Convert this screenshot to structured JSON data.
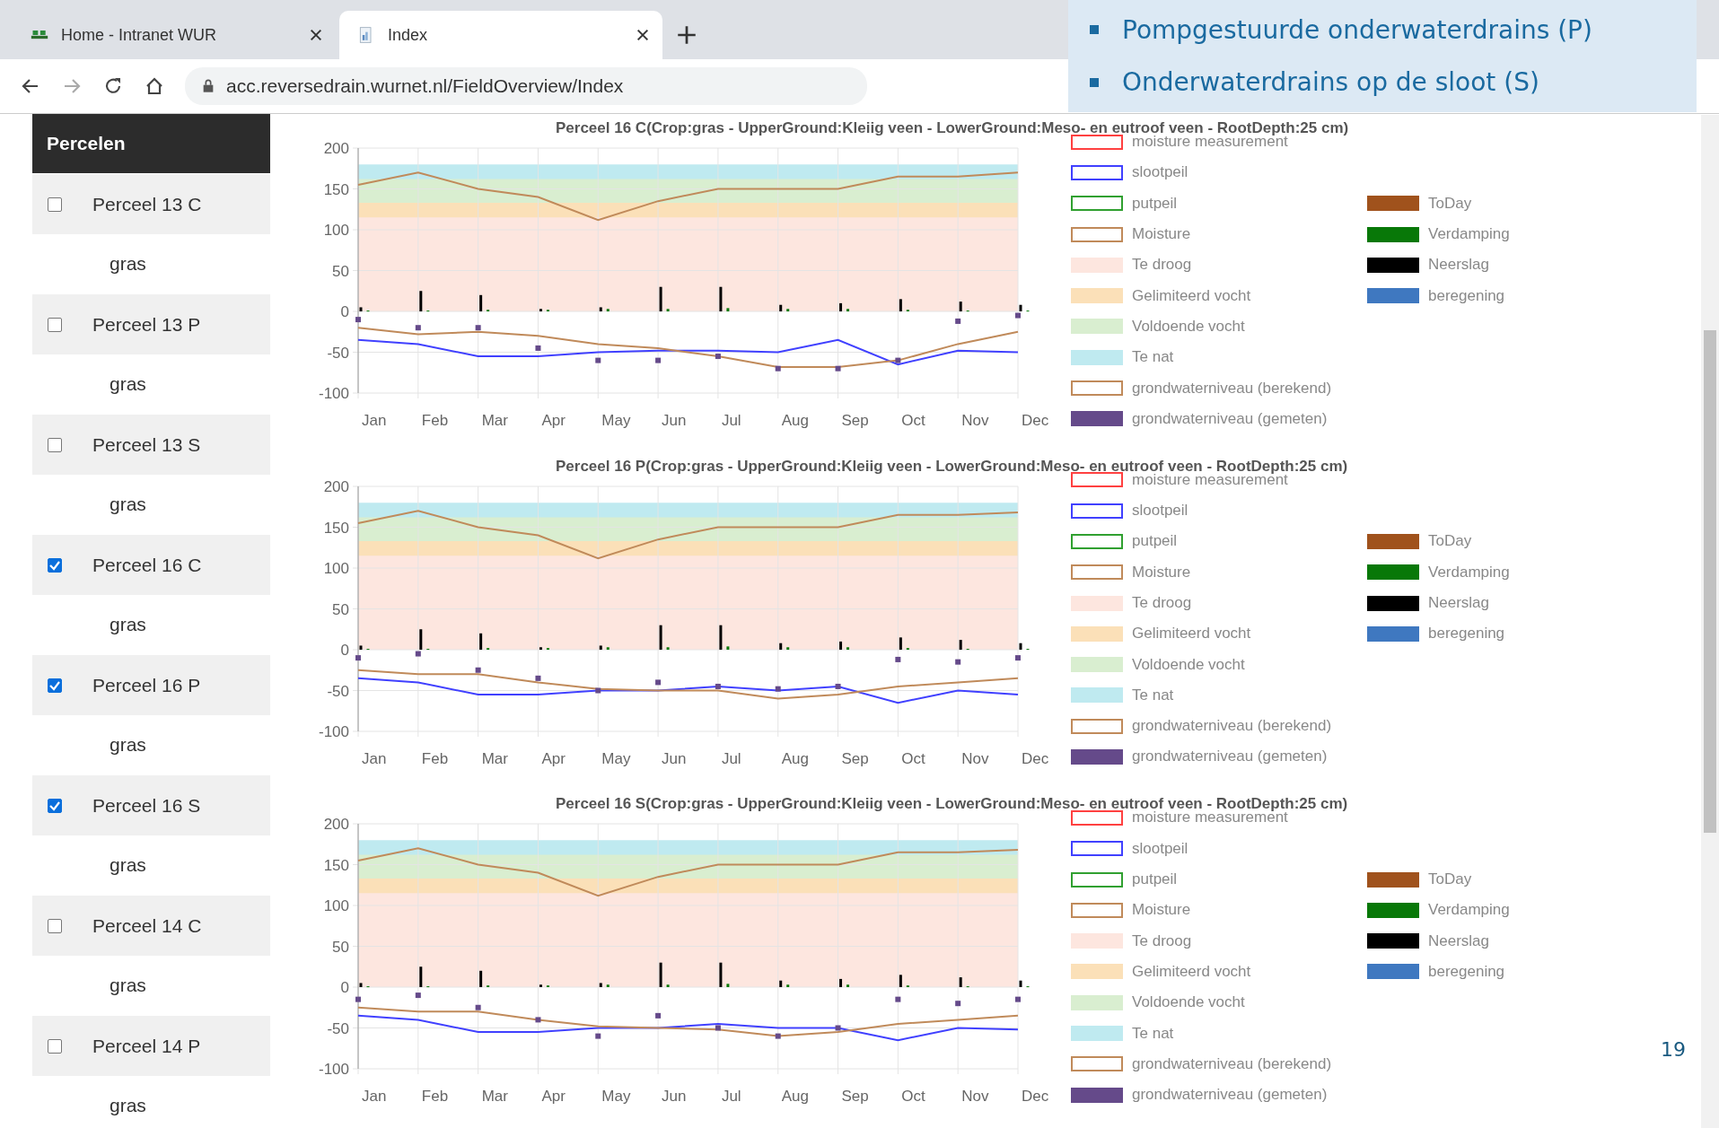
{
  "browser": {
    "tabs": [
      {
        "title": "Home - Intranet WUR",
        "selected": false
      },
      {
        "title": "Index",
        "selected": true
      }
    ],
    "url": "acc.reversedrain.wurnet.nl/FieldOverview/Index"
  },
  "slide": {
    "bullets": [
      "Pompgestuurde onderwaterdrains (P)",
      "Onderwaterdrains op de sloot (S)"
    ],
    "page_number": "19"
  },
  "sidebar": {
    "title": "Percelen",
    "items": [
      {
        "label": "Perceel 13 C",
        "checked": false,
        "crop": "gras"
      },
      {
        "label": "Perceel 13 P",
        "checked": false,
        "crop": "gras"
      },
      {
        "label": "Perceel 13 S",
        "checked": false,
        "crop": "gras"
      },
      {
        "label": "Perceel 16 C",
        "checked": true,
        "crop": "gras"
      },
      {
        "label": "Perceel 16 P",
        "checked": true,
        "crop": "gras"
      },
      {
        "label": "Perceel 16 S",
        "checked": true,
        "crop": "gras"
      },
      {
        "label": "Perceel 14 C",
        "checked": false,
        "crop": "gras"
      },
      {
        "label": "Perceel 14 P",
        "checked": false,
        "crop": "gras"
      }
    ]
  },
  "charts": [
    {
      "chart_data": {
        "type": "line",
        "title": "Perceel 16 C(Crop:gras - UpperGround:Kleiig veen - LowerGround:Meso- en eutroof veen - RootDepth:25 cm)",
        "categories": [
          "Jan",
          "Feb",
          "Mar",
          "Apr",
          "May",
          "Jun",
          "Jul",
          "Aug",
          "Sep",
          "Oct",
          "Nov",
          "Dec"
        ],
        "ylim": [
          -100,
          200
        ],
        "yticks": [
          -100,
          -50,
          0,
          50,
          100,
          150,
          200
        ],
        "grid": true,
        "series": [
          {
            "name": "moisture measurement",
            "color": "#ff4040",
            "type": "line",
            "values": [
              null,
              null,
              null,
              null,
              null,
              null,
              null,
              null,
              null,
              null,
              null,
              null
            ]
          },
          {
            "name": "slootpeil",
            "color": "#4040ff",
            "type": "line",
            "values": [
              -35,
              -40,
              -55,
              -55,
              -50,
              -48,
              -48,
              -50,
              -35,
              -65,
              -48,
              -50
            ]
          },
          {
            "name": "putpeil",
            "color": "#30a030",
            "type": "line",
            "values": [
              null,
              null,
              null,
              null,
              null,
              null,
              null,
              null,
              null,
              null,
              null,
              null
            ]
          },
          {
            "name": "Moisture",
            "color": "#c08a5a",
            "type": "line",
            "values": [
              155,
              170,
              150,
              140,
              112,
              135,
              150,
              150,
              150,
              165,
              165,
              170
            ]
          },
          {
            "name": "Te droog",
            "color": "#fde6df",
            "type": "area",
            "values": [
              115,
              115,
              115,
              115,
              115,
              115,
              115,
              115,
              115,
              115,
              115,
              115
            ]
          },
          {
            "name": "Gelimiteerd vocht",
            "color": "#fbe0b8",
            "type": "area",
            "values": [
              133,
              133,
              133,
              133,
              133,
              133,
              133,
              133,
              133,
              133,
              133,
              133
            ]
          },
          {
            "name": "Voldoende vocht",
            "color": "#d9eed0",
            "type": "area",
            "values": [
              162,
              162,
              162,
              162,
              162,
              162,
              162,
              162,
              162,
              162,
              162,
              162
            ]
          },
          {
            "name": "Te nat",
            "color": "#bfeaf0",
            "type": "area",
            "values": [
              180,
              180,
              180,
              180,
              180,
              180,
              180,
              180,
              180,
              180,
              180,
              180
            ]
          },
          {
            "name": "grondwaterniveau (berekend)",
            "color": "#c08a5a",
            "type": "line",
            "values": [
              -20,
              -28,
              -25,
              -30,
              -40,
              -45,
              -55,
              -68,
              -68,
              -60,
              -40,
              -25
            ]
          },
          {
            "name": "grondwaterniveau (gemeten)",
            "color": "#654a8a",
            "type": "scatter",
            "values": [
              -10,
              -20,
              -20,
              -45,
              -60,
              -60,
              -55,
              -70,
              -70,
              -60,
              -12,
              -5
            ]
          },
          {
            "name": "ToDay",
            "color": "#a0521c",
            "type": "bar",
            "values": [
              null,
              null,
              null,
              null,
              null,
              null,
              null,
              null,
              null,
              null,
              null,
              null
            ]
          },
          {
            "name": "Verdamping",
            "color": "#087808",
            "type": "bar",
            "values": [
              1,
              1,
              2,
              2,
              3,
              3,
              4,
              3,
              3,
              2,
              1,
              1
            ]
          },
          {
            "name": "Neerslag",
            "color": "#000000",
            "type": "bar",
            "values": [
              5,
              25,
              20,
              3,
              5,
              30,
              30,
              8,
              10,
              15,
              12,
              8
            ]
          },
          {
            "name": "beregening",
            "color": "#3f78c0",
            "type": "bar",
            "values": [
              null,
              null,
              null,
              null,
              null,
              null,
              null,
              null,
              null,
              null,
              null,
              null
            ]
          }
        ]
      }
    },
    {
      "chart_data": {
        "type": "line",
        "title": "Perceel 16 P(Crop:gras - UpperGround:Kleiig veen - LowerGround:Meso- en eutroof veen - RootDepth:25 cm)",
        "categories": [
          "Jan",
          "Feb",
          "Mar",
          "Apr",
          "May",
          "Jun",
          "Jul",
          "Aug",
          "Sep",
          "Oct",
          "Nov",
          "Dec"
        ],
        "ylim": [
          -100,
          200
        ],
        "yticks": [
          -100,
          -50,
          0,
          50,
          100,
          150,
          200
        ],
        "grid": true,
        "series": [
          {
            "name": "moisture measurement",
            "color": "#ff4040",
            "type": "line",
            "values": [
              null,
              null,
              null,
              null,
              null,
              null,
              null,
              null,
              null,
              null,
              null,
              null
            ]
          },
          {
            "name": "slootpeil",
            "color": "#4040ff",
            "type": "line",
            "values": [
              -35,
              -40,
              -55,
              -55,
              -50,
              -50,
              -45,
              -50,
              -45,
              -65,
              -50,
              -55
            ]
          },
          {
            "name": "putpeil",
            "color": "#30a030",
            "type": "line",
            "values": [
              null,
              null,
              null,
              null,
              null,
              null,
              null,
              null,
              null,
              null,
              null,
              null
            ]
          },
          {
            "name": "Moisture",
            "color": "#c08a5a",
            "type": "line",
            "values": [
              155,
              170,
              150,
              140,
              112,
              135,
              150,
              150,
              150,
              165,
              165,
              168
            ]
          },
          {
            "name": "Te droog",
            "color": "#fde6df",
            "type": "area",
            "values": [
              115,
              115,
              115,
              115,
              115,
              115,
              115,
              115,
              115,
              115,
              115,
              115
            ]
          },
          {
            "name": "Gelimiteerd vocht",
            "color": "#fbe0b8",
            "type": "area",
            "values": [
              133,
              133,
              133,
              133,
              133,
              133,
              133,
              133,
              133,
              133,
              133,
              133
            ]
          },
          {
            "name": "Voldoende vocht",
            "color": "#d9eed0",
            "type": "area",
            "values": [
              162,
              162,
              162,
              162,
              162,
              162,
              162,
              162,
              162,
              162,
              162,
              162
            ]
          },
          {
            "name": "Te nat",
            "color": "#bfeaf0",
            "type": "area",
            "values": [
              180,
              180,
              180,
              180,
              180,
              180,
              180,
              180,
              180,
              180,
              180,
              180
            ]
          },
          {
            "name": "grondwaterniveau (berekend)",
            "color": "#c08a5a",
            "type": "line",
            "values": [
              -25,
              -30,
              -30,
              -40,
              -48,
              -50,
              -50,
              -60,
              -55,
              -45,
              -40,
              -35
            ]
          },
          {
            "name": "grondwaterniveau (gemeten)",
            "color": "#654a8a",
            "type": "scatter",
            "values": [
              -10,
              -5,
              -25,
              -35,
              -50,
              -40,
              -45,
              -48,
              -45,
              -12,
              -15,
              -10
            ]
          },
          {
            "name": "ToDay",
            "color": "#a0521c",
            "type": "bar",
            "values": [
              null,
              null,
              null,
              null,
              null,
              null,
              null,
              null,
              null,
              null,
              null,
              null
            ]
          },
          {
            "name": "Verdamping",
            "color": "#087808",
            "type": "bar",
            "values": [
              1,
              1,
              2,
              2,
              3,
              3,
              4,
              3,
              3,
              2,
              1,
              1
            ]
          },
          {
            "name": "Neerslag",
            "color": "#000000",
            "type": "bar",
            "values": [
              5,
              25,
              20,
              3,
              5,
              30,
              30,
              8,
              10,
              15,
              12,
              8
            ]
          },
          {
            "name": "beregening",
            "color": "#3f78c0",
            "type": "bar",
            "values": [
              null,
              null,
              null,
              null,
              null,
              null,
              null,
              null,
              null,
              null,
              null,
              null
            ]
          }
        ]
      }
    },
    {
      "chart_data": {
        "type": "line",
        "title": "Perceel 16 S(Crop:gras - UpperGround:Kleiig veen - LowerGround:Meso- en eutroof veen - RootDepth:25 cm)",
        "categories": [
          "Jan",
          "Feb",
          "Mar",
          "Apr",
          "May",
          "Jun",
          "Jul",
          "Aug",
          "Sep",
          "Oct",
          "Nov",
          "Dec"
        ],
        "ylim": [
          -100,
          200
        ],
        "yticks": [
          -100,
          -50,
          0,
          50,
          100,
          150,
          200
        ],
        "grid": true,
        "series": [
          {
            "name": "moisture measurement",
            "color": "#ff4040",
            "type": "line",
            "values": [
              null,
              null,
              null,
              null,
              null,
              null,
              null,
              null,
              null,
              null,
              null,
              null
            ]
          },
          {
            "name": "slootpeil",
            "color": "#4040ff",
            "type": "line",
            "values": [
              -35,
              -40,
              -55,
              -55,
              -50,
              -50,
              -45,
              -50,
              -50,
              -65,
              -50,
              -52
            ]
          },
          {
            "name": "putpeil",
            "color": "#30a030",
            "type": "line",
            "values": [
              null,
              null,
              null,
              null,
              null,
              null,
              null,
              null,
              null,
              null,
              null,
              null
            ]
          },
          {
            "name": "Moisture",
            "color": "#c08a5a",
            "type": "line",
            "values": [
              155,
              170,
              150,
              140,
              112,
              135,
              150,
              150,
              150,
              165,
              165,
              168
            ]
          },
          {
            "name": "Te droog",
            "color": "#fde6df",
            "type": "area",
            "values": [
              115,
              115,
              115,
              115,
              115,
              115,
              115,
              115,
              115,
              115,
              115,
              115
            ]
          },
          {
            "name": "Gelimiteerd vocht",
            "color": "#fbe0b8",
            "type": "area",
            "values": [
              133,
              133,
              133,
              133,
              133,
              133,
              133,
              133,
              133,
              133,
              133,
              133
            ]
          },
          {
            "name": "Voldoende vocht",
            "color": "#d9eed0",
            "type": "area",
            "values": [
              162,
              162,
              162,
              162,
              162,
              162,
              162,
              162,
              162,
              162,
              162,
              162
            ]
          },
          {
            "name": "Te nat",
            "color": "#bfeaf0",
            "type": "area",
            "values": [
              180,
              180,
              180,
              180,
              180,
              180,
              180,
              180,
              180,
              180,
              180,
              180
            ]
          },
          {
            "name": "grondwaterniveau (berekend)",
            "color": "#c08a5a",
            "type": "line",
            "values": [
              -25,
              -30,
              -30,
              -40,
              -48,
              -50,
              -52,
              -60,
              -55,
              -45,
              -40,
              -35
            ]
          },
          {
            "name": "grondwaterniveau (gemeten)",
            "color": "#654a8a",
            "type": "scatter",
            "values": [
              -15,
              -10,
              -25,
              -40,
              -60,
              -35,
              -50,
              -60,
              -50,
              -15,
              -20,
              -15
            ]
          },
          {
            "name": "ToDay",
            "color": "#a0521c",
            "type": "bar",
            "values": [
              null,
              null,
              null,
              null,
              null,
              null,
              null,
              null,
              null,
              null,
              null,
              null
            ]
          },
          {
            "name": "Verdamping",
            "color": "#087808",
            "type": "bar",
            "values": [
              1,
              1,
              2,
              2,
              3,
              3,
              4,
              3,
              3,
              2,
              1,
              1
            ]
          },
          {
            "name": "Neerslag",
            "color": "#000000",
            "type": "bar",
            "values": [
              5,
              25,
              20,
              3,
              5,
              30,
              30,
              8,
              10,
              15,
              12,
              8
            ]
          },
          {
            "name": "beregening",
            "color": "#3f78c0",
            "type": "bar",
            "values": [
              null,
              null,
              null,
              null,
              null,
              null,
              null,
              null,
              null,
              null,
              null,
              null
            ]
          }
        ]
      }
    }
  ]
}
